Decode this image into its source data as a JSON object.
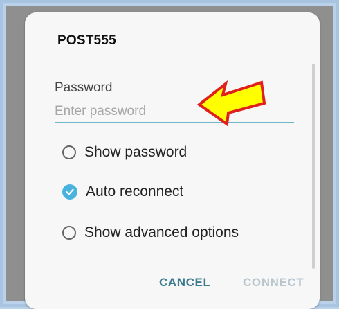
{
  "dialog": {
    "title": "POST555",
    "password_label": "Password",
    "password_value": "",
    "password_placeholder": "Enter password",
    "options": [
      {
        "label": "Show password",
        "checked": false
      },
      {
        "label": "Auto reconnect",
        "checked": true
      },
      {
        "label": "Show advanced options",
        "checked": false
      }
    ],
    "cancel_label": "CANCEL",
    "connect_label": "CONNECT"
  },
  "colors": {
    "accent": "#4ab3dd",
    "input_underline": "#6fb7c8",
    "cancel_text": "#3c7a8e",
    "connect_disabled_text": "#b9c6cd",
    "annotation_arrow_fill": "#ffff00",
    "annotation_arrow_stroke": "#e0201b"
  },
  "annotation": {
    "icon": "yellow-arrow-pointing-left"
  }
}
